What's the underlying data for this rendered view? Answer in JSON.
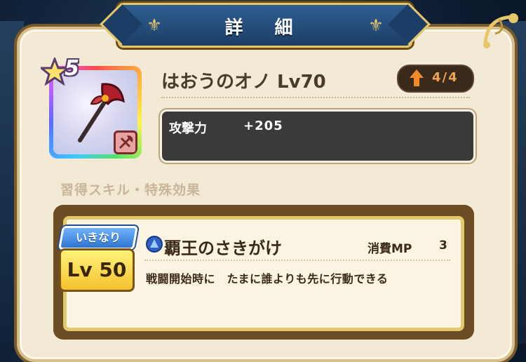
{
  "header": {
    "title": "詳 細"
  },
  "weapon": {
    "rarity": "5",
    "name": "はおうのオノ Lv70",
    "refine": "4/4",
    "stat_label": "攻撃力",
    "stat_value": "+205",
    "icon": "axe-icon"
  },
  "section": {
    "label": "習得スキル・特殊効果"
  },
  "skill": {
    "tag": "いきなり",
    "level": "Lv 50",
    "name": "覇王のさきがけ",
    "mp_label": "消費MP",
    "mp_value": "3",
    "description": "戦闘開始時に　たまに誰よりも先に行動できる"
  },
  "colors": {
    "banner": "#1c3e66",
    "gold": "#e8c76a",
    "parchment": "#f3ead6",
    "refine_text": "#f3a352"
  }
}
